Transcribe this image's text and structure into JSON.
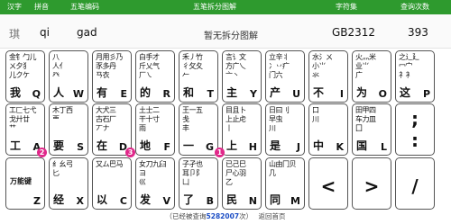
{
  "header": {
    "hanzi": "汉字",
    "pinyin": "拼音",
    "wubi_code": "五笔编码",
    "breakdown": "五笔拆分图解",
    "charset": "字符集",
    "lookup_count": "查询次数"
  },
  "entry": {
    "hanzi": "琪",
    "pinyin": "qi",
    "code": "gad",
    "message": "暂无拆分图解",
    "charset": "GB2312",
    "count": "393"
  },
  "keys": [
    {
      "letter": "Q",
      "example": "我",
      "roots": "金钅勹儿\nㄨ夕犭\n儿クケ"
    },
    {
      "letter": "W",
      "example": "人",
      "roots": "八\n人亻\n癶"
    },
    {
      "letter": "E",
      "example": "有",
      "roots": "月用彡乃\n豕多丹\nㄢ衣"
    },
    {
      "letter": "R",
      "example": "的",
      "roots": "白手才\n斤乂气\n厂㇏"
    },
    {
      "letter": "T",
      "example": "和",
      "roots": "禾丿竹\n彳攵夂\n𠂉"
    },
    {
      "letter": "Y",
      "example": "主",
      "roots": "言讠文\n方广乀\n亠丶"
    },
    {
      "letter": "U",
      "example": "产",
      "roots": "立辛丬\n冫丷疒\n门六"
    },
    {
      "letter": "I",
      "example": "不",
      "roots": "水氵ㄨ\n小⺌\n氺"
    },
    {
      "letter": "O",
      "example": "为",
      "roots": "火灬米\n业⺌\n广"
    },
    {
      "letter": "P",
      "example": "这",
      "roots": "之辶廴\n冖宀\n礻衤"
    },
    {
      "letter": "A",
      "example": "工",
      "roots": "工匚七弋\n戈廾廿\n艹"
    },
    {
      "letter": "S",
      "example": "要",
      "roots": "木丁西\n覀"
    },
    {
      "letter": "D",
      "example": "在",
      "roots": "大犬三\n古石厂\n丆ナ"
    },
    {
      "letter": "F",
      "example": "地",
      "roots": "土士二\n干十寸\n雨"
    },
    {
      "letter": "G",
      "example": "一",
      "roots": "王一五\n戋\n丰"
    },
    {
      "letter": "H",
      "example": "上",
      "roots": "目且卜\n上止虍\n丨"
    },
    {
      "letter": "J",
      "example": "是",
      "roots": "日曰刂\n早虫\n川"
    },
    {
      "letter": "K",
      "example": "中",
      "roots": "口\n川\n"
    },
    {
      "letter": "L",
      "example": "国",
      "roots": "田甲四\n车力皿\n囗"
    },
    {
      "letter": "Z",
      "example": "",
      "roots": "",
      "middle": "万能键"
    },
    {
      "letter": "X",
      "example": "经",
      "roots": "纟幺弓\n匕\n"
    },
    {
      "letter": "C",
      "example": "以",
      "roots": "又ム巴马\n"
    },
    {
      "letter": "V",
      "example": "发",
      "roots": "女刀九臼\nヨ\n巛"
    },
    {
      "letter": "B",
      "example": "了",
      "roots": "子孑也\n耳卩阝\n凵"
    },
    {
      "letter": "N",
      "example": "民",
      "roots": "已己巳\n尸心羽\n乙"
    },
    {
      "letter": "M",
      "example": "同",
      "roots": "山由冂贝\n几\n"
    }
  ],
  "punct": [
    {
      "symbol": ";"
    },
    {
      "symbol": ":"
    },
    {
      "symbol": "<"
    },
    {
      "symbol": ">"
    },
    {
      "symbol": "/"
    }
  ],
  "badges": [
    "1",
    "2",
    "3"
  ],
  "footer": {
    "prefix": "（已经被查询",
    "count": "5282007",
    "suffix": "次）",
    "link": "返回首页"
  }
}
